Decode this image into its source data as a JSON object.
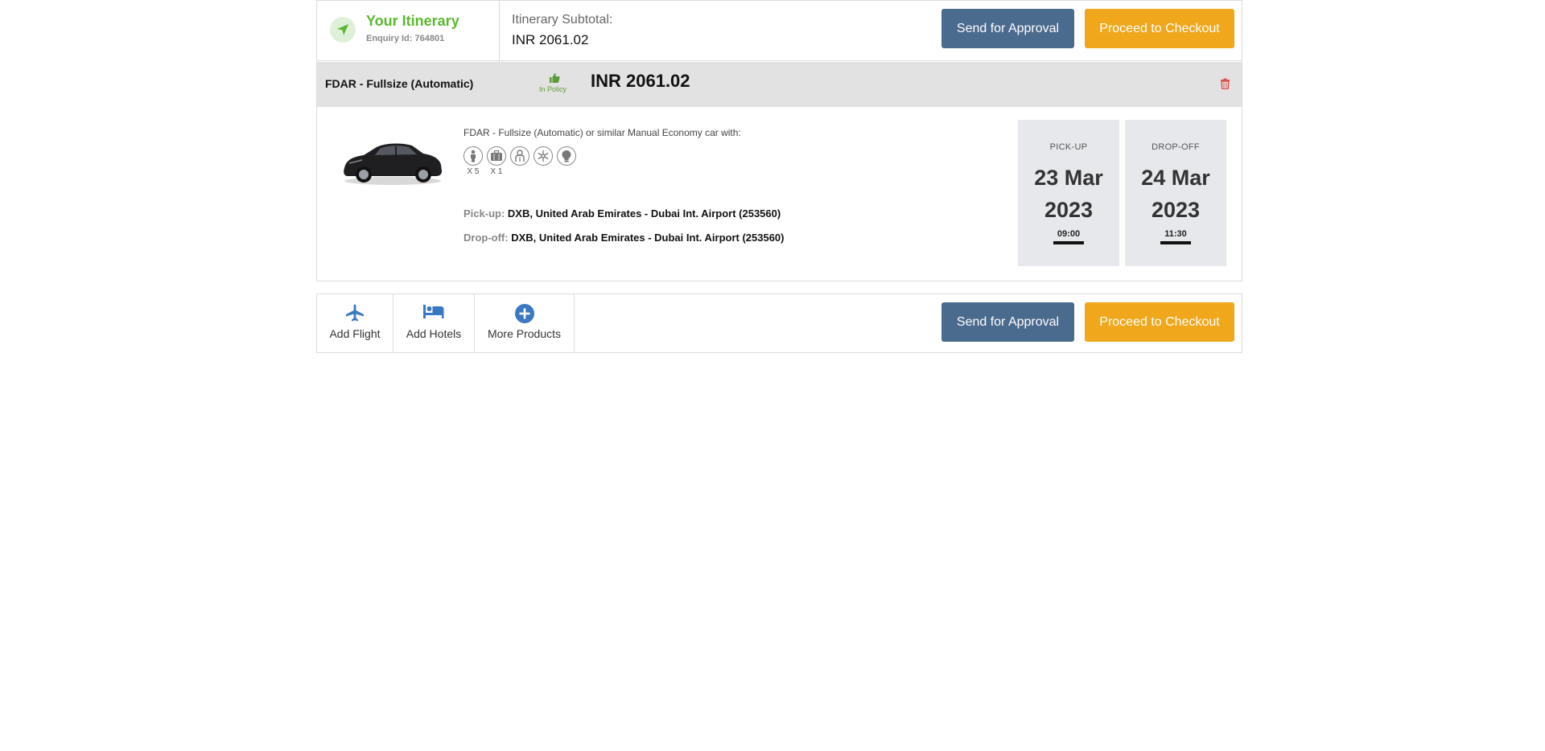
{
  "header": {
    "title": "Your Itinerary",
    "enquiry": "Enquiry Id: 764801",
    "subtotal_label": "Itinerary Subtotal:",
    "subtotal_value": "INR  2061.02",
    "send_approval": "Send for Approval",
    "checkout": "Proceed to Checkout"
  },
  "product": {
    "name": "FDAR - Fullsize (Automatic)",
    "policy_label": "In Policy",
    "price": "INR 2061.02",
    "description": "FDAR - Fullsize (Automatic) or similar Manual Economy car with:",
    "features": [
      "passenger-icon",
      "luggage-icon",
      "transmission-icon",
      "air-conditioning-icon",
      "fuel-icon"
    ],
    "passengers": "X 5",
    "luggage": "X 1",
    "pickup_label": "Pick-up:",
    "pickup_location": "DXB, United Arab Emirates - Dubai Int. Airport (253560)",
    "dropoff_label": "Drop-off:",
    "dropoff_location": "DXB, United Arab Emirates - Dubai Int. Airport (253560)",
    "pickup_box": {
      "label": "PICK-UP",
      "day_month": "23 Mar",
      "year": "2023",
      "time": "09:00"
    },
    "dropoff_box": {
      "label": "DROP-OFF",
      "day_month": "24 Mar",
      "year": "2023",
      "time": "11:30"
    }
  },
  "footer": {
    "add_flight": "Add Flight",
    "add_hotels": "Add Hotels",
    "more_products": "More Products",
    "send_approval": "Send for Approval",
    "checkout": "Proceed to Checkout"
  },
  "colors": {
    "brand_green": "#5cb82e",
    "approval_blue": "#4a6a8e",
    "checkout_orange": "#f0a71b",
    "icon_blue": "#3a78c2",
    "delete_red": "#d9534f"
  }
}
